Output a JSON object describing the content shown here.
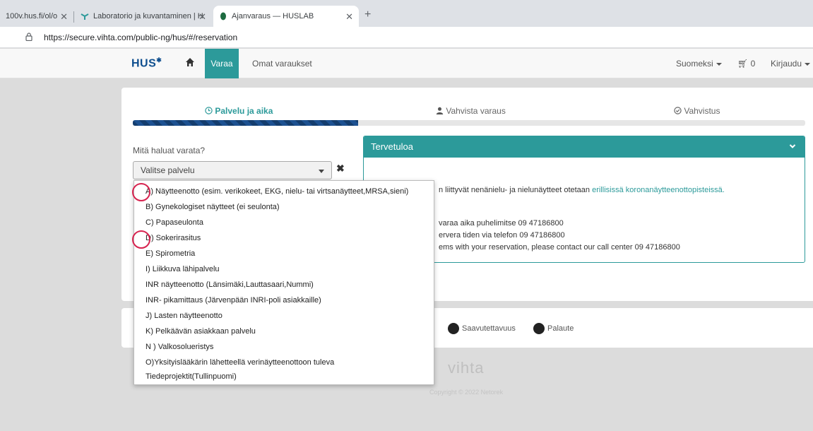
{
  "browser": {
    "tabs": [
      {
        "title": "100v.hus.fi/ol/o"
      },
      {
        "title": "Laboratorio ja kuvantaminen | H"
      },
      {
        "title": "Ajanvaraus — HUSLAB"
      }
    ],
    "url": "https://secure.vihta.com/public-ng/hus/#/reservation"
  },
  "nav": {
    "logo": "HUS",
    "book": "Varaa",
    "my_bookings": "Omat varaukset",
    "language": "Suomeksi",
    "cart_count": "0",
    "login": "Kirjaudu"
  },
  "steps": [
    {
      "label": "Palvelu ja aika"
    },
    {
      "label": "Vahvista varaus"
    },
    {
      "label": "Vahvistus"
    }
  ],
  "progress_fraction": 0.335,
  "form": {
    "question": "Mitä haluat varata?",
    "select_placeholder": "Valitse palvelu"
  },
  "welcome": {
    "title": "Tervetuloa",
    "lines": [
      "n liittyvät nenänielu- ja nielunäytteet otetaan",
      "erillisissä koronanäytteenottopisteissä.",
      "varaa aika puhelimitse 09 47186800",
      "ervera tiden via telefon 09 47186800",
      "ems with your reservation, please contact our call center 09 47186800"
    ]
  },
  "footer": {
    "accessibility": "Saavutettavuus",
    "feedback": "Palaute",
    "brand": "vihta",
    "copyright": "Copyright © 2022 Netorek"
  },
  "options": [
    {
      "label": "A) Näytteenotto (esim. verikokeet, EKG, nielu- tai virtsanäytteet,MRSA,sieni)"
    },
    {
      "label": "B) Gynekologiset näytteet (ei seulonta)"
    },
    {
      "label": "C) Papaseulonta"
    },
    {
      "label": "D) Sokerirasitus"
    },
    {
      "label": "E) Spirometria"
    },
    {
      "label": "I) Liikkuva lähipalvelu"
    },
    {
      "label": "INR näytteenotto (Länsimäki,Lauttasaari,Nummi)"
    },
    {
      "label": "INR- pikamittaus (Järvenpään INRI-poli asiakkaille)"
    },
    {
      "label": "J) Lasten näytteenotto"
    },
    {
      "label": "K) Pelkäävän asiakkaan palvelu"
    },
    {
      "label": "N ) Valkosolueristys"
    },
    {
      "label": "O)Yksityislääkärin lähetteellä verinäytteenottoon tuleva"
    },
    {
      "label": "Tiedeprojektit(Tullinpuomi)"
    }
  ],
  "colors": {
    "accent": "#2c9a9a",
    "progress": "#143d6e",
    "annotation": "#d7234f"
  }
}
